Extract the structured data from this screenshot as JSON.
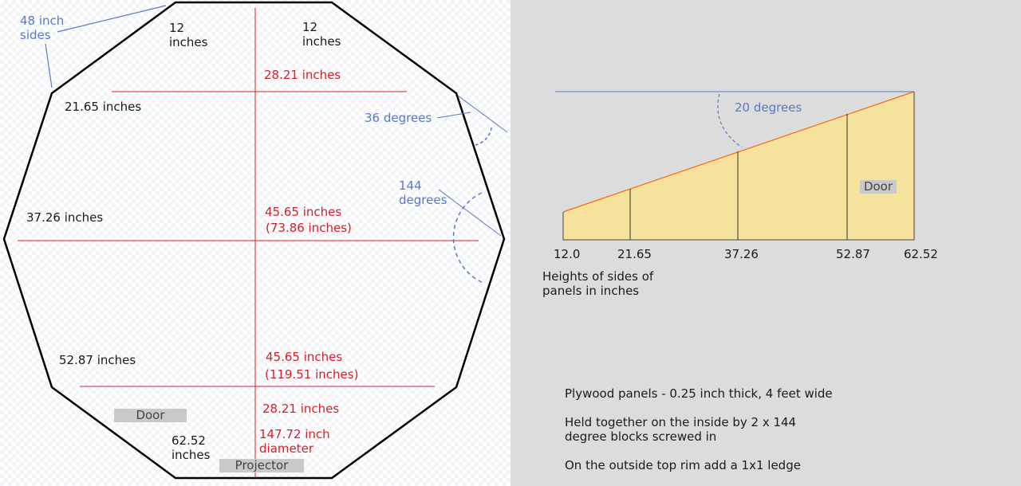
{
  "octagon": {
    "side_label": "48 inch sides",
    "side_label_line1": "48 inch",
    "side_label_line2": "sides",
    "top_left_panel": [
      "12",
      "inches"
    ],
    "top_right_panel": [
      "12",
      "inches"
    ],
    "bottom_panel": [
      "62.52",
      "inches"
    ],
    "panel_heights_left": [
      "21.65 inches",
      "37.26 inches",
      "52.87 inches"
    ],
    "chord_lengths": [
      "28.21 inches",
      "45.65 inches",
      "(73.86 inches)",
      "45.65 inches",
      "(119.51 inches)",
      "28.21 inches"
    ],
    "diameter_label": [
      "147.72 inch",
      "diameter"
    ],
    "angle_outer": "36 degrees",
    "angle_inner": [
      "144",
      "degrees"
    ],
    "door_tag": "Door",
    "projector_tag": "Projector"
  },
  "profile": {
    "slope_angle": "20 degrees",
    "door_tag": "Door",
    "heights": [
      "12.0",
      "21.65",
      "37.26",
      "52.87",
      "62.52"
    ],
    "height_values": [
      12.0,
      21.65,
      37.26,
      52.87,
      62.52
    ],
    "caption": [
      "Heights of sides of",
      "panels in inches"
    ]
  },
  "notes": [
    "Plywood panels - 0.25 inch thick, 4 feet wide",
    "Held together on the inside by 2 x 144",
    "degree blocks screwed in",
    "On the outside top rim add a 1x1 ledge"
  ],
  "colors": {
    "outline": "#000000",
    "measure_red": "#d3202a",
    "annotation_blue": "#5a77c8",
    "panel_fill": "#f5e29c",
    "slope_line": "#ff6600",
    "right_bg": "#dcdcdc"
  }
}
